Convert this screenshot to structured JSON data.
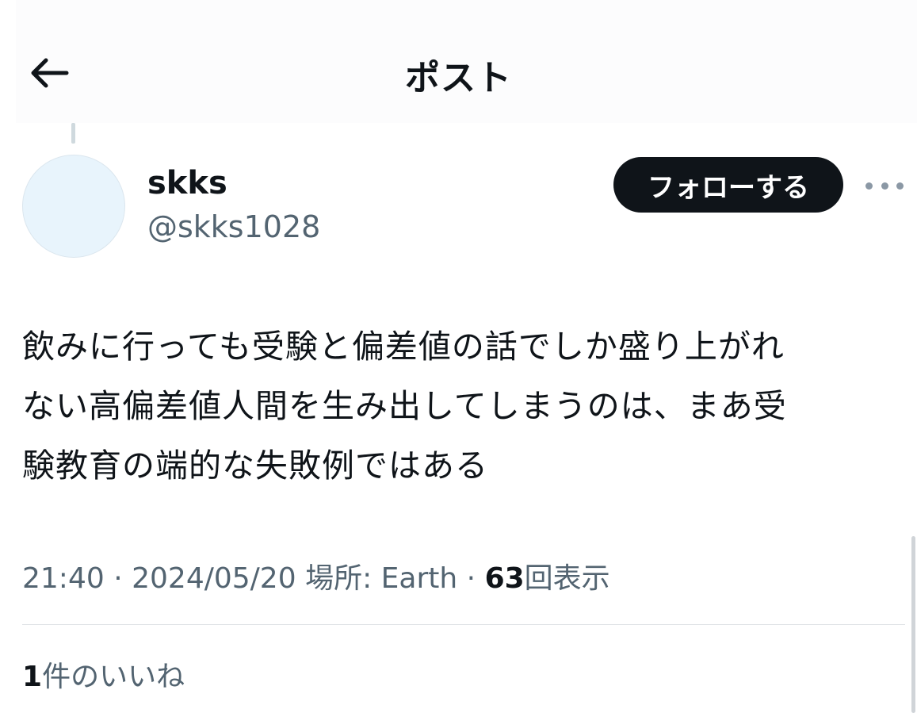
{
  "header": {
    "title": "ポスト",
    "back_icon": "arrow-left-icon"
  },
  "author": {
    "display_name": "skks",
    "handle": "@skks1028"
  },
  "actions": {
    "follow_label": "フォローする",
    "more_icon": "more-horizontal-icon"
  },
  "post": {
    "text_lines": [
      "飲みに行っても受験と偏差値の話でしか盛り上がれ",
      "ない高偏差値人間を生み出してしまうのは、まあ受",
      "験教育の端的な失敗例ではある"
    ],
    "time": "21:40",
    "separator": "·",
    "date": "2024/05/20",
    "location_label": "場所:",
    "location_value": "Earth",
    "views_count": "63",
    "views_label": "回表示"
  },
  "stats": {
    "likes_count": "1",
    "likes_label": "件のいいね"
  },
  "colors": {
    "text_primary": "#0f1419",
    "text_secondary": "#536471",
    "follow_button_bg": "#0f1419",
    "avatar_bg": "#e8f4fc"
  }
}
